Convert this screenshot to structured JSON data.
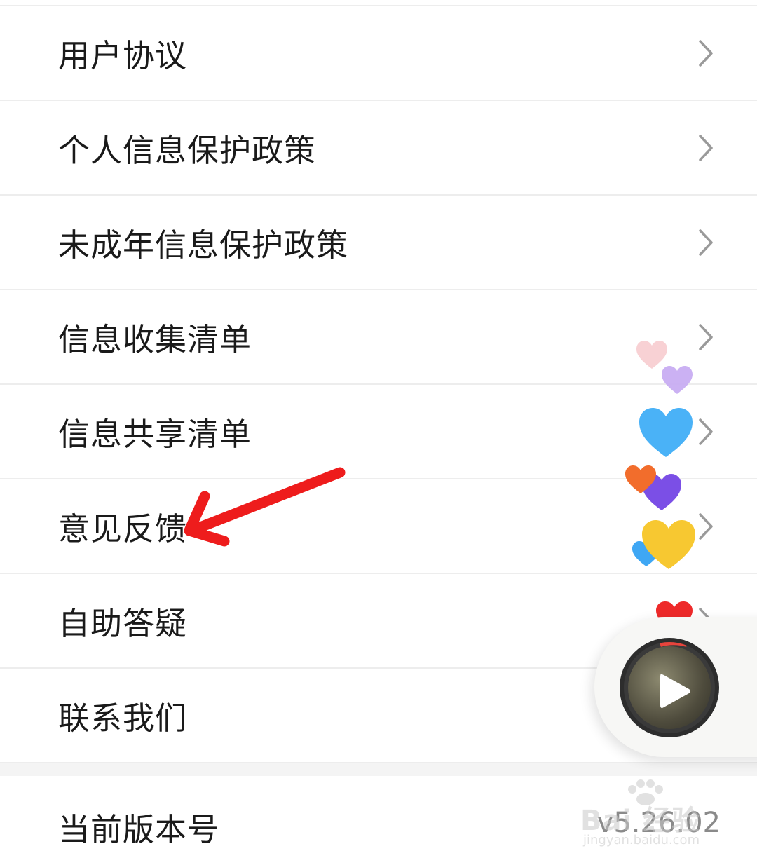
{
  "menu": {
    "items": [
      {
        "label": "用户协议"
      },
      {
        "label": "个人信息保护政策"
      },
      {
        "label": "未成年信息保护政策"
      },
      {
        "label": "信息收集清单"
      },
      {
        "label": "信息共享清单"
      },
      {
        "label": "意见反馈"
      },
      {
        "label": "自助答疑"
      },
      {
        "label": "联系我们"
      }
    ]
  },
  "version": {
    "label": "当前版本号",
    "value": "v5.26.02"
  },
  "watermark": {
    "brand": "Bai 经验",
    "site": "jingyan.baidu.com"
  },
  "icons": {
    "chevron": "chevron-right-icon",
    "arrow": "red-arrow-annotation",
    "play": "play-icon"
  },
  "colors": {
    "text": "#1a1a1a",
    "divider": "#ededed",
    "chevron": "#9a9a9a",
    "arrow": "#ee1c1c",
    "version_value": "#8a8a8a"
  }
}
